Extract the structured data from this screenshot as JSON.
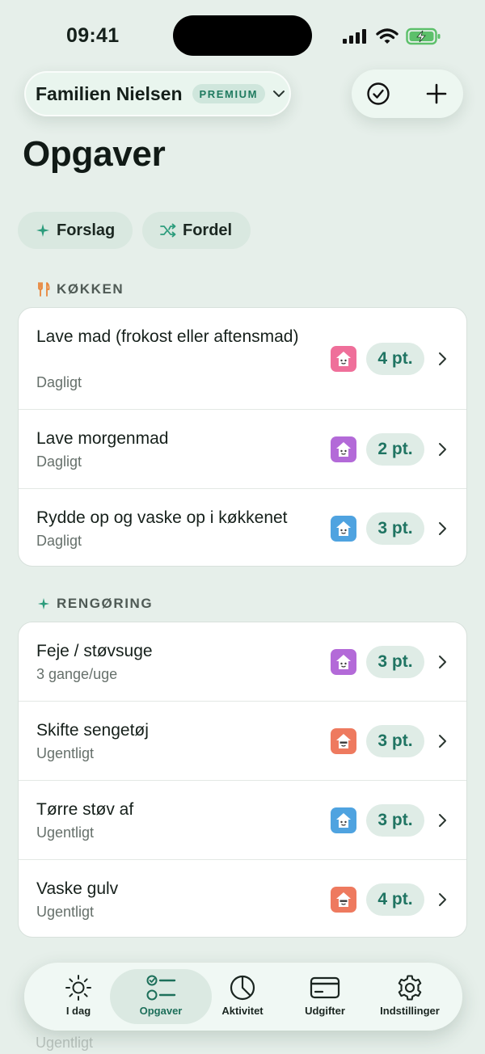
{
  "status": {
    "time": "09:41"
  },
  "header": {
    "family_name": "Familien Nielsen",
    "premium_label": "PREMIUM"
  },
  "page": {
    "title": "Opgaver"
  },
  "chips": [
    {
      "label": "Forslag",
      "icon": "sparkle-icon"
    },
    {
      "label": "Fordel",
      "icon": "shuffle-icon"
    }
  ],
  "sections": [
    {
      "title": "KØKKEN",
      "icon": "fork-knife-icon",
      "tasks": [
        {
          "title": "Lave mad (frokost eller aftensmad)",
          "frequency": "Dagligt",
          "points": "4 pt.",
          "avatar_color": "#ef6f9a"
        },
        {
          "title": "Lave morgenmad",
          "frequency": "Dagligt",
          "points": "2 pt.",
          "avatar_color": "#b36ad8"
        },
        {
          "title": "Rydde op og vaske op i køkkenet",
          "frequency": "Dagligt",
          "points": "3 pt.",
          "avatar_color": "#4fa3e0"
        }
      ]
    },
    {
      "title": "RENGØRING",
      "icon": "sparkle-icon",
      "tasks": [
        {
          "title": "Feje / støvsuge",
          "frequency": "3 gange/uge",
          "points": "3 pt.",
          "avatar_color": "#b36ad8"
        },
        {
          "title": "Skifte sengetøj",
          "frequency": "Ugentligt",
          "points": "3 pt.",
          "avatar_color": "#ee7a5f"
        },
        {
          "title": "Tørre støv af",
          "frequency": "Ugentligt",
          "points": "3 pt.",
          "avatar_color": "#4fa3e0"
        },
        {
          "title": "Vaske gulv",
          "frequency": "Ugentligt",
          "points": "4 pt.",
          "avatar_color": "#ee7a5f"
        }
      ]
    }
  ],
  "partial": {
    "frequency": "Ugentligt"
  },
  "tabs": [
    {
      "label": "I dag",
      "icon": "sun-icon"
    },
    {
      "label": "Opgaver",
      "icon": "checklist-icon"
    },
    {
      "label": "Aktivitet",
      "icon": "pie-chart-icon"
    },
    {
      "label": "Udgifter",
      "icon": "credit-card-icon"
    },
    {
      "label": "Indstillinger",
      "icon": "gear-icon"
    }
  ],
  "colors": {
    "accent": "#1f7a5f",
    "background": "#e6efea",
    "points_bg": "#dfece6",
    "section_icon_kitchen": "#e8853a",
    "section_icon_cleaning": "#2c9c7c"
  }
}
